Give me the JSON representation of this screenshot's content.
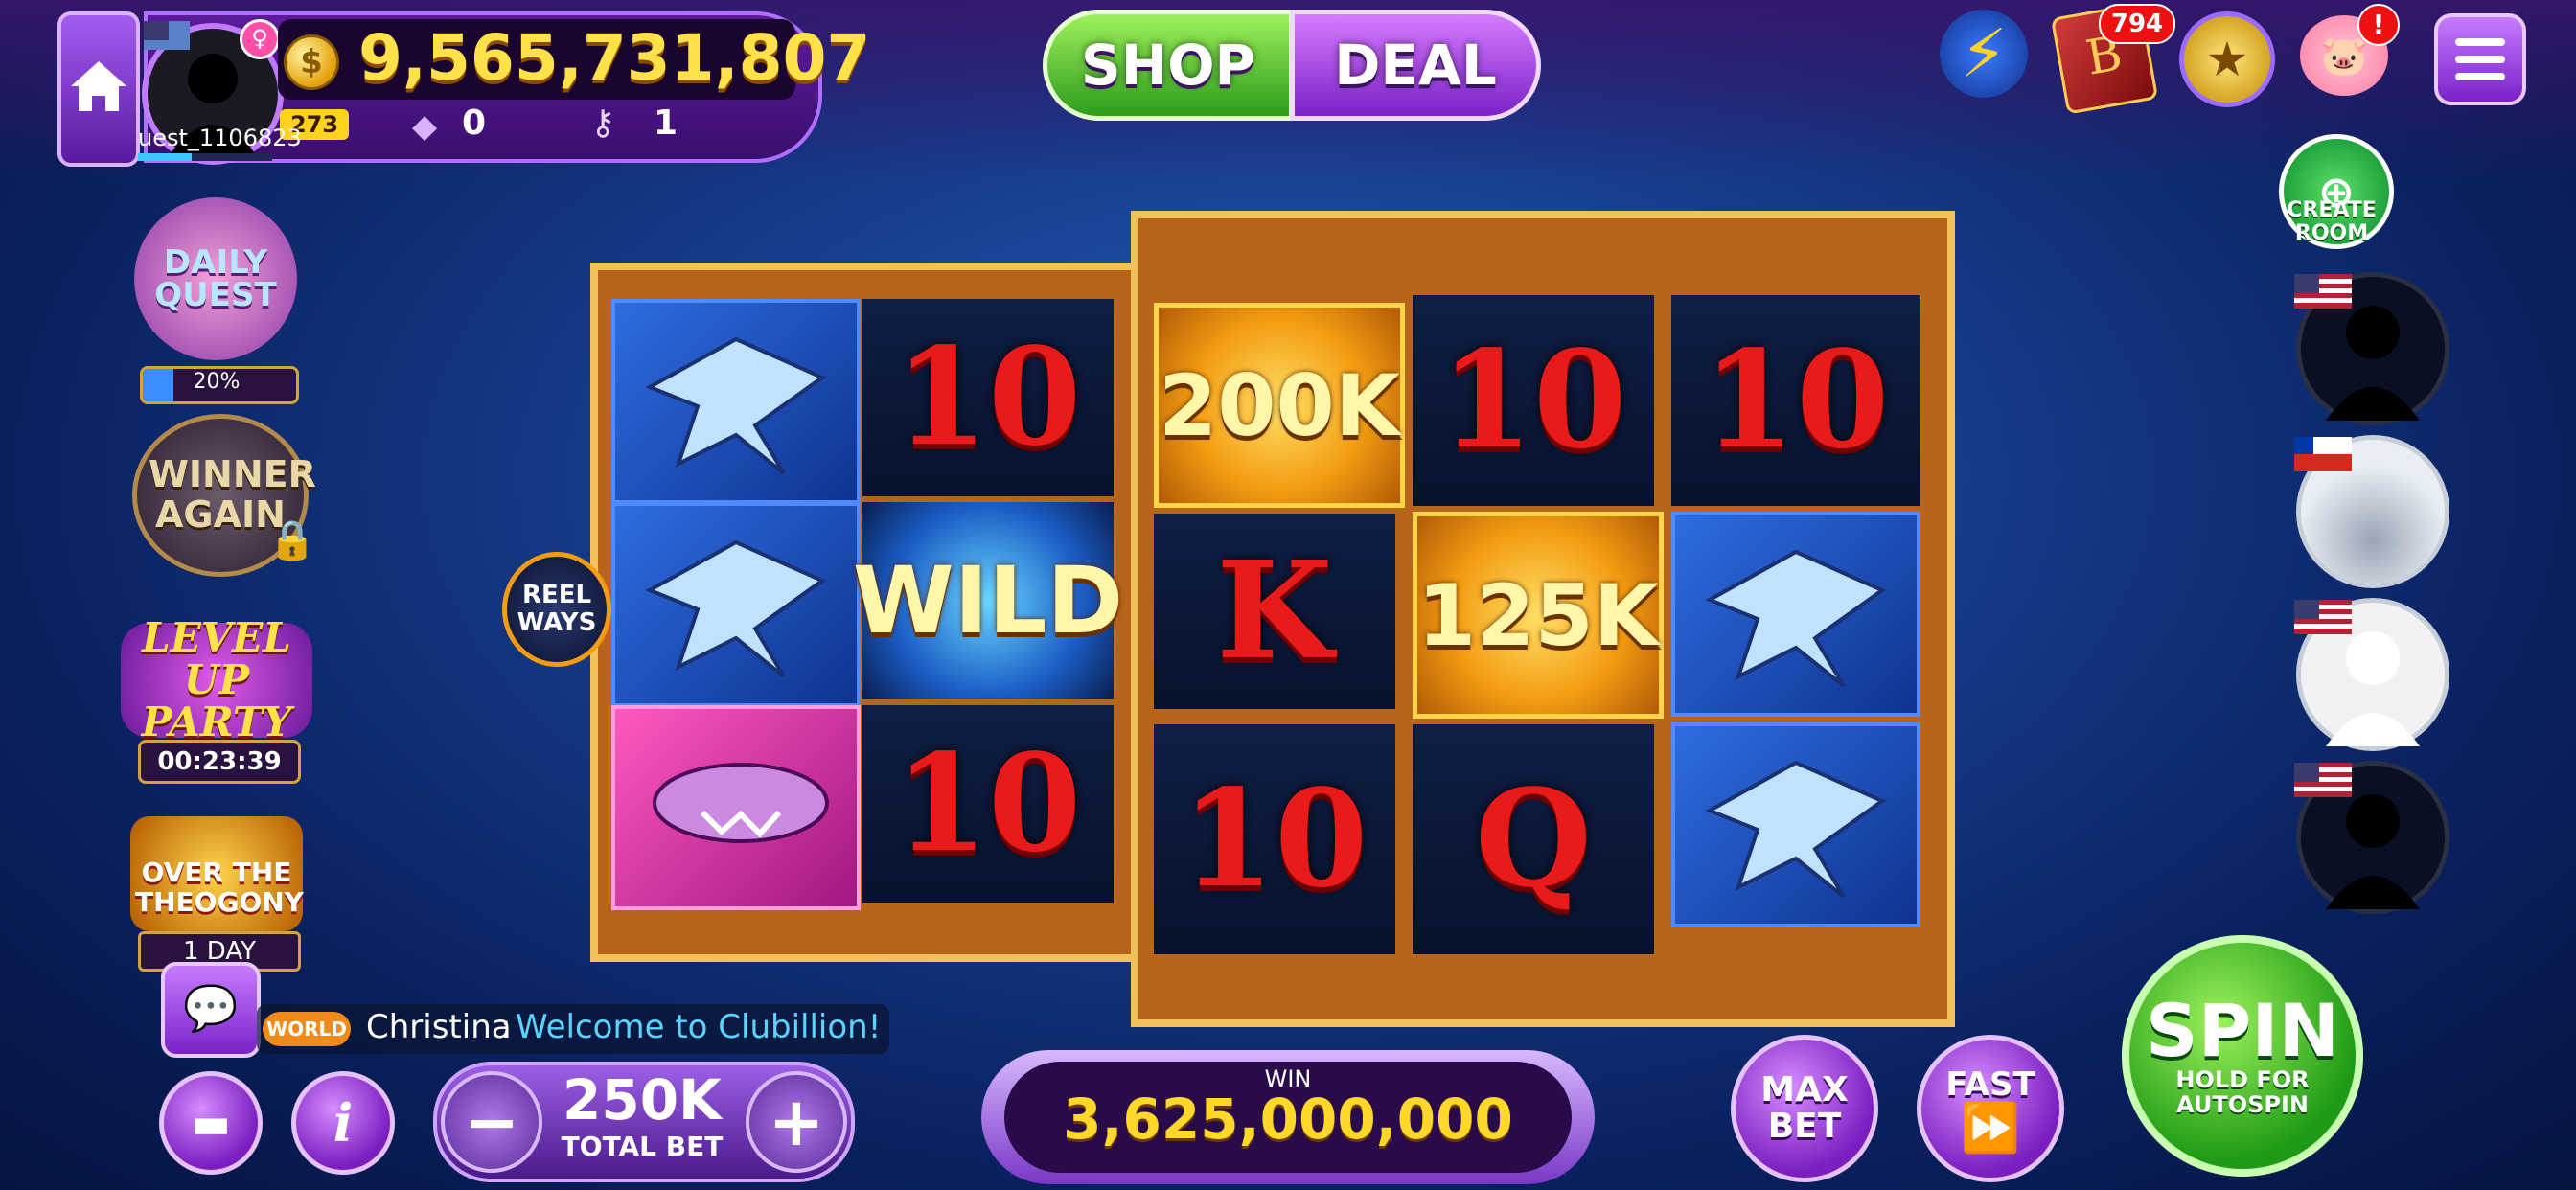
{
  "header": {
    "coins": "9,565,731,807",
    "level": "273",
    "gems": "0",
    "keys": "1",
    "username": "uest_1106823",
    "shop_label": "SHOP",
    "deal_label": "DEAL",
    "book_badge": "794",
    "bank_alert": "!"
  },
  "left_panel": {
    "daily_quest": {
      "label": "DAILY QUEST",
      "progress_text": "20%",
      "progress": 0.2
    },
    "winner_again": "WINNER AGAIN",
    "level_up_party": {
      "label": "LEVEL UP PARTY",
      "timer": "00:23:39"
    },
    "event": {
      "label": "OVER THE THEOGONY",
      "duration": "1 DAY"
    }
  },
  "reel_ways_label": "REEL WAYS",
  "reels": {
    "left": {
      "col1": [
        "stingray",
        "stingray",
        "hammerhead"
      ],
      "col2": [
        "10",
        "WILD",
        "10"
      ],
      "wild_label": "WILD"
    },
    "right": {
      "col1": [
        "200K",
        "K",
        "10"
      ],
      "col2": [
        "10",
        "125K",
        "Q"
      ],
      "col3": [
        "10",
        "stingray",
        "stingray"
      ]
    }
  },
  "right_panel": {
    "create_room": "CREATE ROOM"
  },
  "chat": {
    "channel": "WORLD",
    "user": "Christina",
    "message": "Welcome to Clubillion!"
  },
  "bottom": {
    "bet_value": "250K",
    "bet_label": "TOTAL BET",
    "win_label": "WIN",
    "win_value": "3,625,000,000",
    "max_bet": "MAX BET",
    "fast": "FAST",
    "spin_label": "SPIN",
    "spin_sub": "HOLD FOR AUTOSPIN"
  },
  "colors": {
    "accent_purple": "#7a22c8",
    "gold": "#f3c15a",
    "spin_green": "#1f9a16"
  }
}
